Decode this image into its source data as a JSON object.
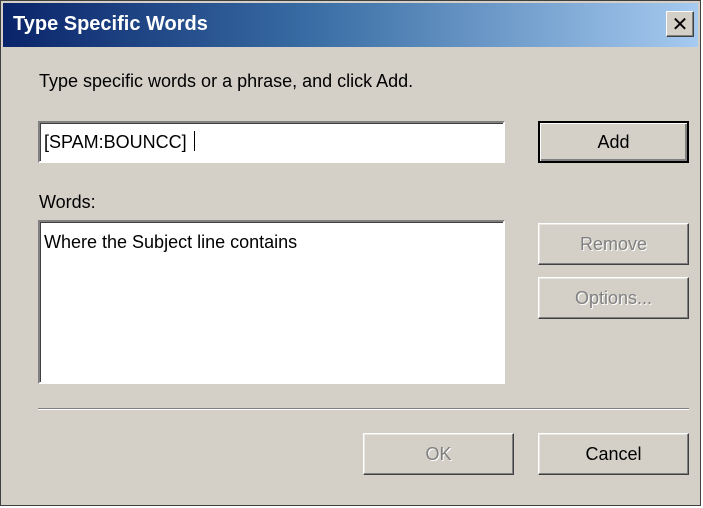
{
  "window": {
    "title": "Type Specific Words",
    "close_glyph": "✕"
  },
  "prompt_text": "Type specific words or a phrase, and click Add.",
  "input": {
    "value": "[SPAM:BOUNCC] "
  },
  "buttons": {
    "add": "Add",
    "remove": "Remove",
    "options": "Options...",
    "ok": "OK",
    "cancel": "Cancel"
  },
  "words": {
    "label": "Words:",
    "items": [
      "Where the Subject line contains"
    ]
  },
  "colors": {
    "titlebar_start": "#0a246a",
    "titlebar_end": "#a6caf0",
    "face": "#d4d0c8",
    "disabled_text": "#808080"
  }
}
